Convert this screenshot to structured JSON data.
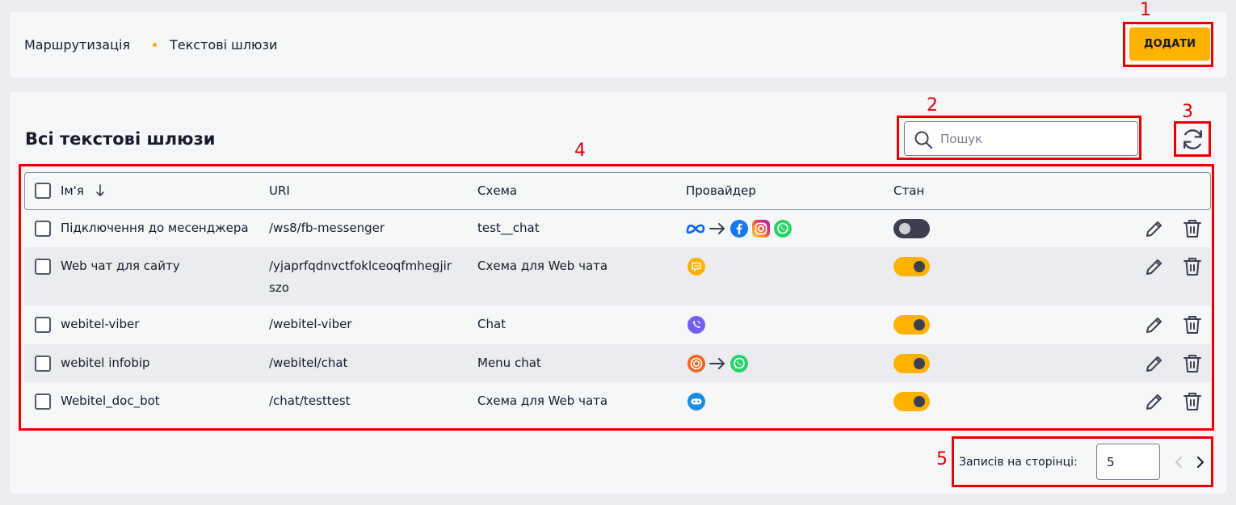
{
  "breadcrumb": {
    "item1": "Маршрутизація",
    "item2": "Текстові шлюзи"
  },
  "header": {
    "add_label": "ДОДАТИ"
  },
  "main": {
    "title": "Всі текстові шлюзи"
  },
  "search": {
    "placeholder": "Пошук",
    "value": ""
  },
  "table": {
    "columns": [
      "Ім'я",
      "URI",
      "Схема",
      "Провайдер",
      "Стан"
    ],
    "rows": [
      {
        "name": "Підключення до месенджера",
        "uri": "/ws8/fb-messenger",
        "schema": "test__chat",
        "provider": [
          "meta-icon",
          "arrow-icon",
          "facebook-icon",
          "instagram-icon",
          "whatsapp-icon"
        ],
        "enabled": false
      },
      {
        "name": "Web чат для сайту",
        "uri": "/yjaprfqdnvctfoklceoqfmhegjirszo",
        "uri_line1": "/yjaprfqdnvctfoklceoqfmhegjir",
        "uri_line2": "szo",
        "schema": "Схема для Web чата",
        "provider": [
          "webchat-icon"
        ],
        "enabled": true
      },
      {
        "name": "webitel-viber",
        "uri": "/webitel-viber",
        "schema": "Chat",
        "provider": [
          "viber-icon"
        ],
        "enabled": true
      },
      {
        "name": "webitel infobip",
        "uri": "/webitel/chat",
        "schema": "Menu chat",
        "provider": [
          "infobip-icon",
          "arrow-icon",
          "whatsapp-icon"
        ],
        "enabled": true
      },
      {
        "name": "Webitel_doc_bot",
        "uri": "/chat/testtest",
        "schema": "Схема для Web чата",
        "provider": [
          "bot-icon"
        ],
        "enabled": true
      }
    ]
  },
  "pagination": {
    "label": "Записів на сторінці:",
    "size": "5"
  },
  "annotations": {
    "n1": "1",
    "n2": "2",
    "n3": "3",
    "n4": "4",
    "n5": "5"
  },
  "colors": {
    "accent": "#ffb100",
    "annotation": "#e60000",
    "toggle_off": "#3d3f51"
  }
}
